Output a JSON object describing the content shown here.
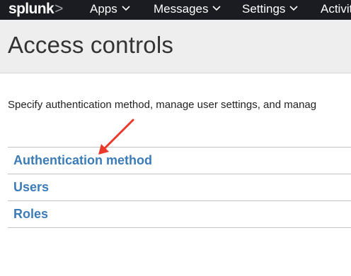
{
  "brand": {
    "logo_text": "splunk",
    "logo_mark": ">"
  },
  "nav": {
    "items": [
      {
        "label": "Apps"
      },
      {
        "label": "Messages"
      },
      {
        "label": "Settings"
      },
      {
        "label": "Activit"
      }
    ]
  },
  "page": {
    "title": "Access controls",
    "description": "Specify authentication method, manage user settings, and manag"
  },
  "links": [
    {
      "label": "Authentication method"
    },
    {
      "label": "Users"
    },
    {
      "label": "Roles"
    }
  ],
  "colors": {
    "nav_background": "#1a1c21",
    "title_bar_background": "#eeeeee",
    "link": "#3a7bb8",
    "annotation_arrow": "#e8392b"
  }
}
